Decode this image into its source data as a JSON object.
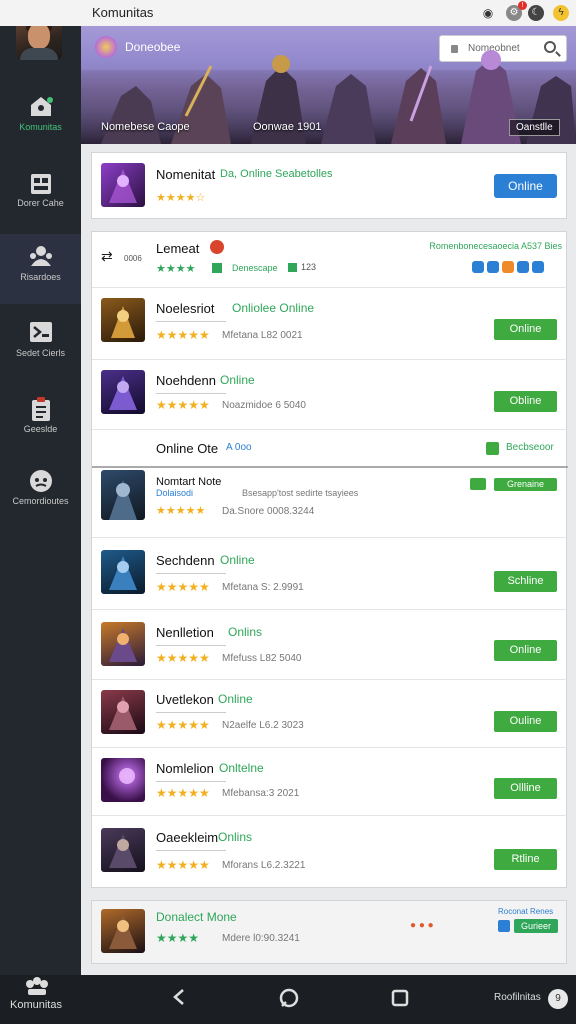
{
  "app": {
    "title": "Komunitas"
  },
  "topbar": {
    "icons": [
      "vr-icon",
      "settings-icon",
      "alert-icon",
      "lightning-icon"
    ]
  },
  "sidebar": {
    "items": [
      {
        "label": "Komunitas",
        "icon": "home-icon",
        "active": false,
        "green": true
      },
      {
        "label": "Dorer Cahe",
        "icon": "store-icon",
        "active": false,
        "green": false
      },
      {
        "label": "Risardoes",
        "icon": "people-icon",
        "active": true,
        "green": false
      },
      {
        "label": "Sedet Cierls",
        "icon": "grid-icon",
        "active": false,
        "green": false
      },
      {
        "label": "Geeslde",
        "icon": "clipboard-icon",
        "active": false,
        "green": false
      },
      {
        "label": "Cemordioutes",
        "icon": "chat-icon",
        "active": false,
        "green": false
      }
    ]
  },
  "banner": {
    "title": "Doneobee",
    "search_placeholder": "Nomeobnet",
    "caption_left": "Nomebese Caope",
    "caption_mid": "Oonwae 1901",
    "caption_right": "Oanstlle"
  },
  "featured": {
    "name": "Nomenitat",
    "tag": "Da, Online Seabetolles",
    "stars": "★★★★☆",
    "button": "Online"
  },
  "section2": {
    "header": {
      "name": "Lemeat",
      "code": "0006",
      "right_text": "Romenbonecesaoecia A537 Bies",
      "sub": "Denescape",
      "count": "123",
      "stars": "★★★★"
    },
    "rows": [
      {
        "name": "Noelesriot",
        "tag": "Onliolee Online",
        "meta": "Mfetana L82 0021",
        "stars": "★★★★★",
        "button": "Online"
      },
      {
        "name": "Noehdenn",
        "tag": "Online",
        "meta": "Noazmidoe 6 5040",
        "stars": "★★★★★",
        "button": "Obline"
      }
    ],
    "inline_header": {
      "name": "Online Ote",
      "tag": "A 0oo",
      "right": "Becbseoor"
    },
    "expanded": {
      "name": "Nomtart Note",
      "sub": "Dolaisodi",
      "extra": "Bsesapp'tost sedirte tsayiees",
      "meta": "Da.Snore 0008.3244",
      "button": "Grenaine",
      "stars": "★★★★★"
    },
    "rows2": [
      {
        "name": "Sechdenn",
        "tag": "Online",
        "meta": "Mfetana S: 2.9991",
        "stars": "★★★★★",
        "button": "Schline"
      },
      {
        "name": "Nenlletion",
        "tag": "Onlins",
        "meta": "Mfefuss L82 5040",
        "stars": "★★★★★",
        "button": "Online"
      },
      {
        "name": "Uvetlekon",
        "tag": "Online",
        "meta": "N2aelfe L6.2 3023",
        "stars": "★★★★★",
        "button": "Ouline"
      },
      {
        "name": "Nomlelion",
        "tag": "Onltelne",
        "meta": "Mfebansa:3 2021",
        "stars": "★★★★★",
        "button": "Ollline"
      },
      {
        "name": "Oaeekleim",
        "tag": "Onlins",
        "meta": "Mforans L6.2.3221",
        "stars": "★★★★★",
        "button": "Rtline"
      }
    ]
  },
  "footer_row": {
    "name": "Donalect Mone",
    "meta": "Mdere l0:90.3241",
    "stars": "★★★★",
    "right_top": "Roconat Renes",
    "right_button": "Gurieer"
  },
  "bottomnav": {
    "label": "Komunitas",
    "right_label": "Roofilnitas"
  }
}
